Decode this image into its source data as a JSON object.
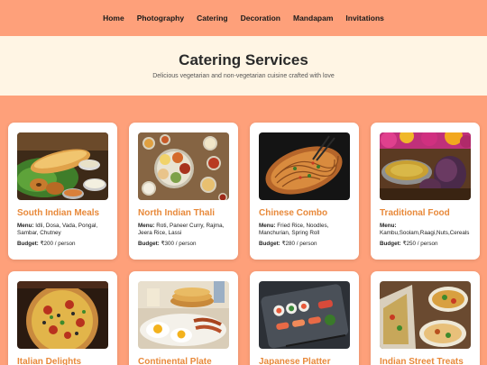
{
  "nav": {
    "items": [
      "Home",
      "Photography",
      "Catering",
      "Decoration",
      "Mandapam",
      "Invitations"
    ]
  },
  "hero": {
    "title": "Catering Services",
    "subtitle": "Delicious vegetarian and non-vegetarian cuisine crafted with love"
  },
  "labels": {
    "menu": "Menu:",
    "budget": "Budget:"
  },
  "cards": [
    {
      "title": "South Indian Meals",
      "menu": "Idli, Dosa, Vada, Pongal, Sambar, Chutney",
      "budget": "₹200 / person",
      "image": "south-indian-meals-photo"
    },
    {
      "title": "North Indian Thali",
      "menu": "Roti, Paneer Curry, Rajma, Jeera Rice, Lassi",
      "budget": "₹300 / person",
      "image": "north-indian-thali-photo"
    },
    {
      "title": "Chinese Combo",
      "menu": "Fried Rice, Noodles, Manchurian, Spring Roll",
      "budget": "₹280 / person",
      "image": "chinese-combo-photo"
    },
    {
      "title": "Traditional Food",
      "menu": "Kambu,Soolam,Raagi,Nuts,Cereals",
      "budget": "₹250 / person",
      "image": "traditional-food-photo"
    },
    {
      "title": "Italian Delights",
      "image": "italian-pizza-photo"
    },
    {
      "title": "Continental Plate",
      "image": "continental-breakfast-photo"
    },
    {
      "title": "Japanese Platter",
      "image": "japanese-sushi-photo"
    },
    {
      "title": "Indian Street Treats",
      "image": "indian-street-food-photo"
    }
  ],
  "colors": {
    "page_background": "#fea07a",
    "hero_background": "#fff5e4",
    "card_title": "#e8893a"
  }
}
